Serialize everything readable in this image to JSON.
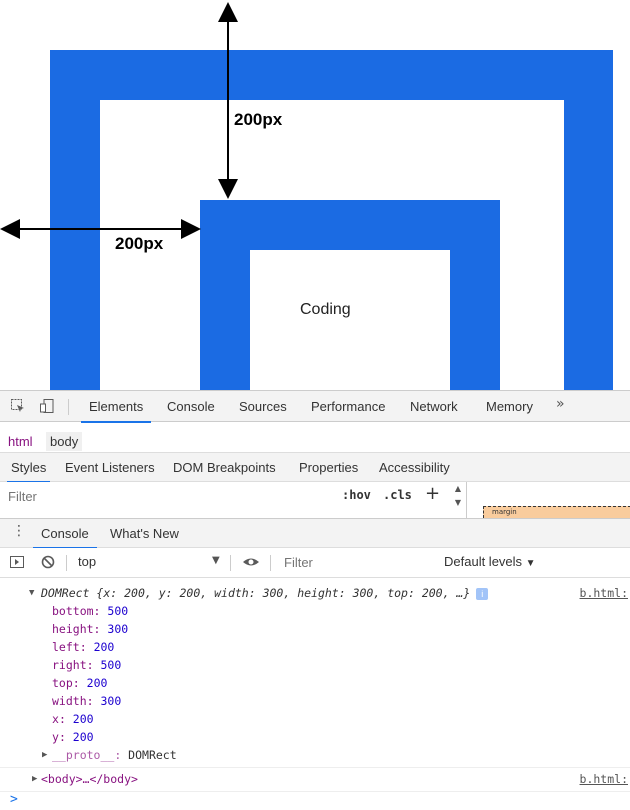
{
  "page": {
    "coding_text": "Coding",
    "measure_vertical": "200px",
    "measure_horizontal": "200px",
    "colors": {
      "box_blue": "#1b6be3",
      "accent": "#1a73e8"
    }
  },
  "devtools": {
    "tabs": [
      "Elements",
      "Console",
      "Sources",
      "Performance",
      "Network",
      "Memory"
    ],
    "active_tab": "Elements",
    "more_label": "»",
    "breadcrumbs": [
      "html",
      "body"
    ],
    "style_tabs": [
      "Styles",
      "Event Listeners",
      "DOM Breakpoints",
      "Properties",
      "Accessibility"
    ],
    "filter_placeholder": "Filter",
    "hov_label": ":hov",
    "cls_label": ".cls",
    "add_label": "+",
    "box_model_label": "margin"
  },
  "drawer": {
    "tabs": [
      "Console",
      "What's New"
    ],
    "context": "top",
    "filter_placeholder": "Filter",
    "levels": "Default levels"
  },
  "console": {
    "summary_type": "DOMRect",
    "summary_text": "{x: 200, y: 200, width: 300, height: 300, top: 200, …}",
    "source": "b.html:",
    "props": [
      {
        "key": "bottom",
        "value": "500"
      },
      {
        "key": "height",
        "value": "300"
      },
      {
        "key": "left",
        "value": "200"
      },
      {
        "key": "right",
        "value": "500"
      },
      {
        "key": "top",
        "value": "200"
      },
      {
        "key": "width",
        "value": "300"
      },
      {
        "key": "x",
        "value": "200"
      },
      {
        "key": "y",
        "value": "200"
      }
    ],
    "proto_key": "__proto__",
    "proto_value": "DOMRect",
    "body_line": "<body>…</body>",
    "body_source": "b.html:",
    "prompt_symbol": ">"
  }
}
